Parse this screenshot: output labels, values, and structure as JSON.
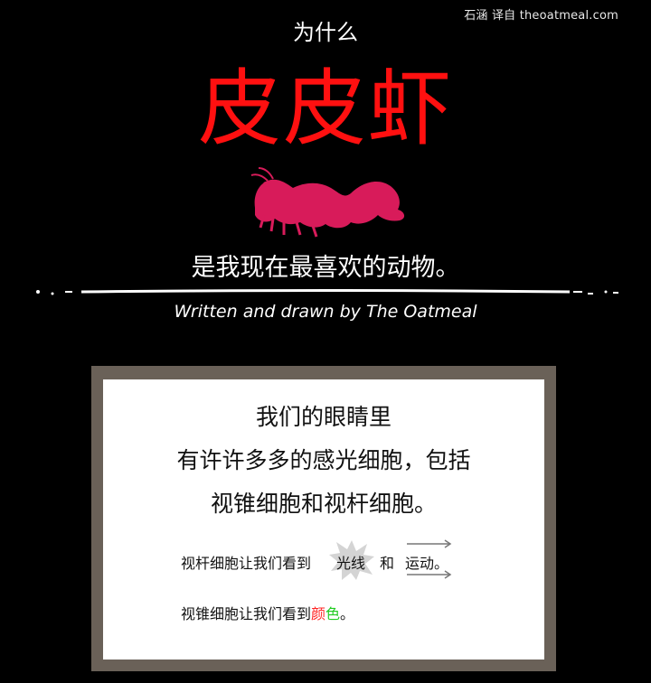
{
  "header": {
    "credit": "石涵 译自 theoatmeal.com",
    "why": "为什么",
    "title": "皮皮虾",
    "tagline": "是我现在最喜欢的动物。",
    "byline": "Written and drawn by The Oatmeal"
  },
  "panel": {
    "line1": "我们的眼睛里",
    "line2": "有许许多多的感光细胞，包括",
    "line3": "视锥细胞和视杆细胞。",
    "rods_prefix": "视杆细胞让我们看到",
    "rods_light": "光线",
    "rods_and": "和",
    "rods_motion": "运动。",
    "cones_prefix": "视锥细胞让我们看到",
    "cones_color_1": "颜",
    "cones_color_2": "色",
    "cones_suffix": "。"
  },
  "colors": {
    "background": "#000000",
    "title_red": "#ff1010",
    "shrimp_pink": "#d81b5a",
    "frame_brown": "#6a6158",
    "panel_white": "#ffffff",
    "color_word_red": "#ff2222",
    "color_word_green": "#22cc22"
  },
  "icons": {
    "shrimp": "mantis-shrimp-silhouette",
    "light": "light-burst",
    "motion": "motion-arrows"
  }
}
